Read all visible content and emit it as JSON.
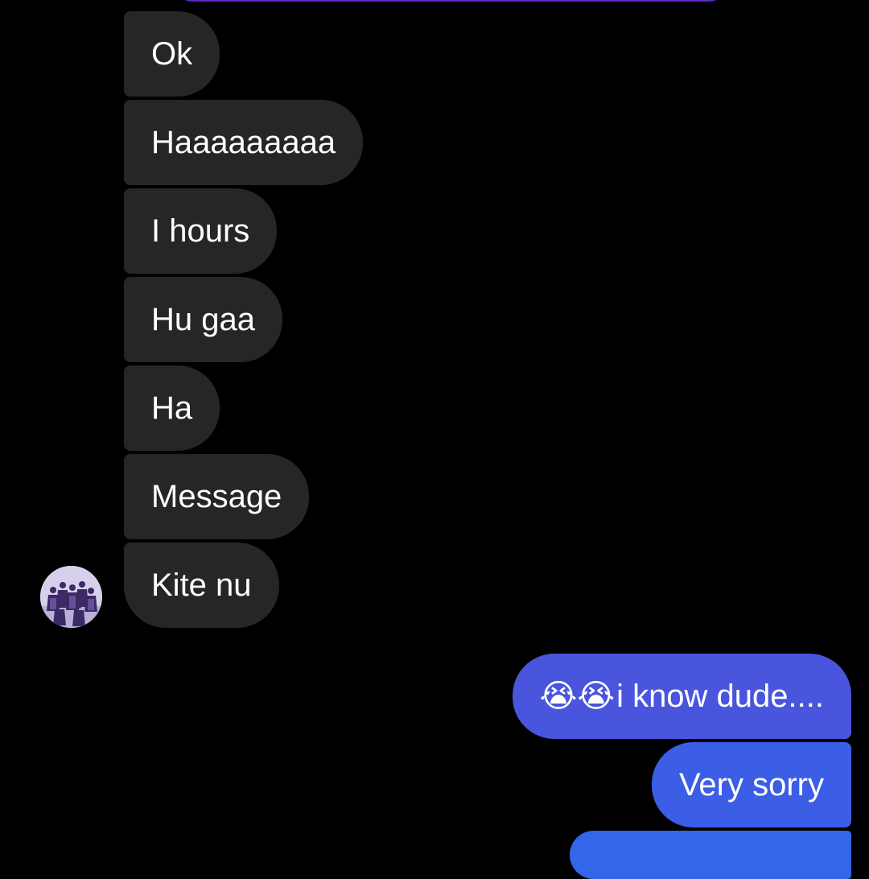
{
  "colors": {
    "background": "#000000",
    "incoming_bubble": "#262626",
    "outgoing_bubble_top": "#4a55dd",
    "outgoing_bubble_mid": "#3c5ee6",
    "outgoing_bubble_bottom": "#3466ea",
    "top_peek_bubble": "#5b2bc4",
    "text": "#ffffff"
  },
  "conversation": {
    "incoming_messages": [
      {
        "text": "Ok"
      },
      {
        "text": "Haaaaaaaaa"
      },
      {
        "text": "I hours"
      },
      {
        "text": "Hu gaa"
      },
      {
        "text": "Ha"
      },
      {
        "text": "Message"
      },
      {
        "text": "Kite nu"
      }
    ],
    "outgoing_messages": [
      {
        "emoji": "😭😭",
        "text": "i know dude...."
      },
      {
        "text": "Very sorry"
      }
    ]
  },
  "icons": {
    "avatar": "group-photo-avatar",
    "emoji": "loudly-crying-face"
  }
}
